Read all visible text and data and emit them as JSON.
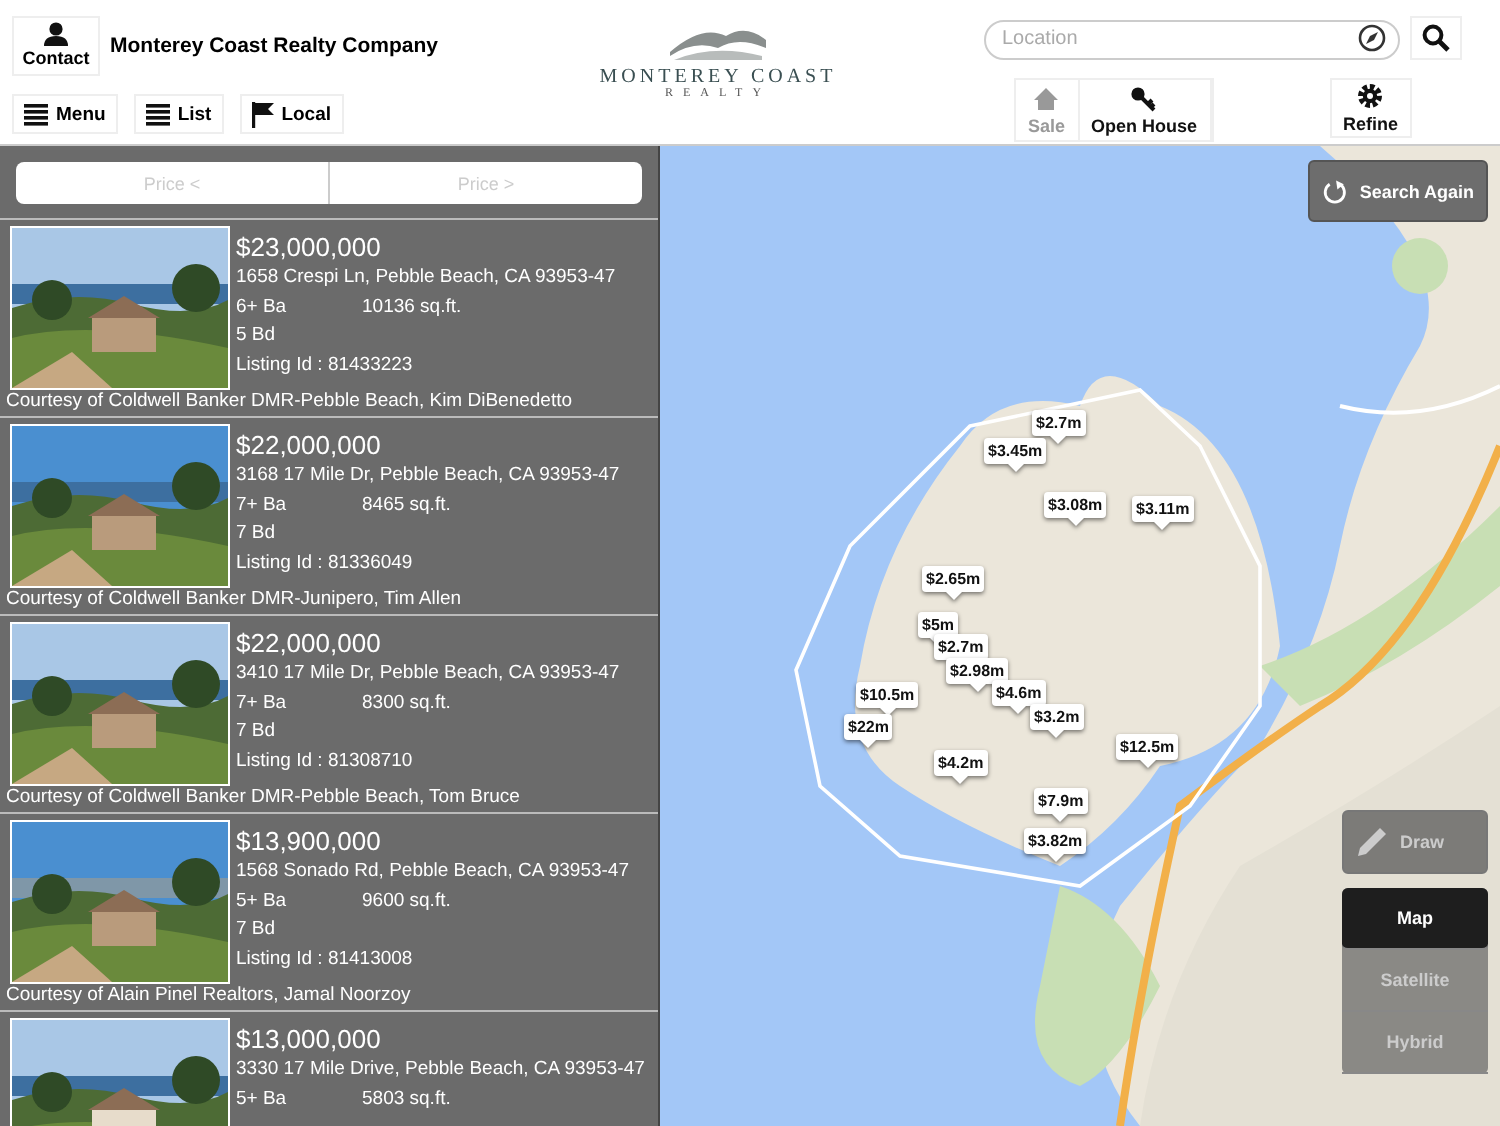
{
  "header": {
    "contact": "Contact",
    "company": "Monterey Coast Realty Company",
    "nav": [
      "Menu",
      "List",
      "Local"
    ],
    "logo": {
      "name": "MONTEREY COAST",
      "sub": "REALTY"
    },
    "location": {
      "placeholder": "Location"
    },
    "modes": [
      {
        "kind": "sale",
        "label": "Sale",
        "selected": true
      },
      {
        "kind": "open",
        "label": "Open House",
        "selected": false
      }
    ],
    "refine": "Refine"
  },
  "sort": [
    "Price <",
    "Price >"
  ],
  "listings": [
    {
      "price": "$23,000,000",
      "address": "1658 Crespi Ln, Pebble Beach, CA 93953-47",
      "baths": "6+ Ba",
      "sqft": "10136 sq.ft.",
      "beds": "5 Bd",
      "listing_id": "Listing Id : 81433223",
      "courtesy": "Courtesy of Coldwell Banker DMR-Pebble Beach, Kim DiBenedetto"
    },
    {
      "price": "$22,000,000",
      "address": "3168 17 Mile Dr, Pebble Beach, CA 93953-47",
      "baths": "7+ Ba",
      "sqft": "8465 sq.ft.",
      "beds": "7 Bd",
      "listing_id": "Listing Id : 81336049",
      "courtesy": "Courtesy of Coldwell Banker DMR-Junipero, Tim Allen"
    },
    {
      "price": "$22,000,000",
      "address": "3410 17 Mile Dr, Pebble Beach, CA 93953-47",
      "baths": "7+ Ba",
      "sqft": "8300 sq.ft.",
      "beds": "7 Bd",
      "listing_id": "Listing Id : 81308710",
      "courtesy": "Courtesy of Coldwell Banker DMR-Pebble Beach, Tom Bruce"
    },
    {
      "price": "$13,900,000",
      "address": "1568 Sonado Rd, Pebble Beach, CA 93953-47",
      "baths": "5+ Ba",
      "sqft": "9600 sq.ft.",
      "beds": "7 Bd",
      "listing_id": "Listing Id : 81413008",
      "courtesy": "Courtesy of Alain Pinel Realtors, Jamal Noorzoy"
    },
    {
      "price": "$13,000,000",
      "address": "3330 17 Mile Drive, Pebble Beach, CA 93953-47",
      "baths": "5+ Ba",
      "sqft": "5803 sq.ft."
    }
  ],
  "map": {
    "search_again": "Search Again",
    "draw": "Draw",
    "map_types": [
      {
        "label": "Map",
        "selected": true
      },
      {
        "label": "Satellite",
        "selected": false
      },
      {
        "label": "Hybrid",
        "selected": false
      }
    ],
    "pins": [
      "$2.7m",
      "$3.45m",
      "$3.08m",
      "$3.11m",
      "$2.65m",
      "$5m",
      "$2.7m",
      "$2.98m",
      "$4.6m",
      "$10.5m",
      "$3.2m",
      "$22m",
      "$12.5m",
      "$4.2m",
      "$7.9m",
      "$3.82m"
    ]
  }
}
